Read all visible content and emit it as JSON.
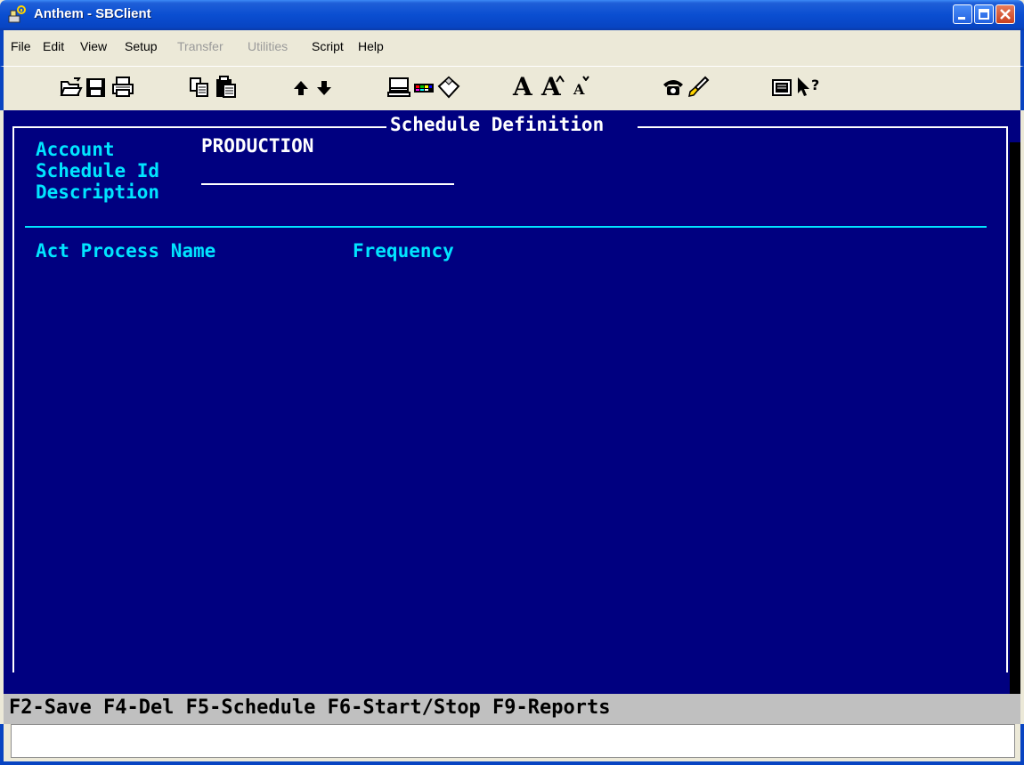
{
  "window": {
    "title": "Anthem - SBClient",
    "app_icon": "terminal-plug-icon",
    "controls": [
      "minimize-icon",
      "maximize-icon",
      "close-icon"
    ]
  },
  "menu": [
    {
      "label": "File",
      "enabled": true
    },
    {
      "label": "Edit",
      "enabled": true
    },
    {
      "label": "View",
      "enabled": true
    },
    {
      "label": "Setup",
      "enabled": true
    },
    {
      "label": "Transfer",
      "enabled": false
    },
    {
      "label": "Utilities",
      "enabled": false
    },
    {
      "label": "Script",
      "enabled": true
    },
    {
      "label": "Help",
      "enabled": true
    }
  ],
  "toolbar": {
    "icons": [
      "open-folder-icon",
      "save-icon",
      "print-icon",
      "copy-icon",
      "paste-icon",
      "arrow-up-icon",
      "arrow-down-icon",
      "monitor-icon",
      "color-palette-icon",
      "clear-icon",
      "font-large-icon",
      "font-increase-icon",
      "font-decrease-icon",
      "phone-icon",
      "brush-icon",
      "screen-icon",
      "help-pointer-icon"
    ],
    "font_large_label": "A",
    "font_increase_label": "A",
    "font_decrease_label": "A"
  },
  "screen": {
    "title": "Schedule Definition",
    "fields": {
      "account_label": "Account",
      "account_value": "PRODUCTION",
      "schedule_id_label": "Schedule Id",
      "description_label": "Description"
    },
    "columns": {
      "act_process_name": "Act Process Name",
      "frequency": "Frequency"
    },
    "colors": {
      "background": "#000080",
      "label": "#00e5ff",
      "value": "#ffffff"
    }
  },
  "function_keys": "F2-Save F4-Del F5-Schedule F6-Start/Stop F9-Reports",
  "status": {
    "input_value": ""
  }
}
